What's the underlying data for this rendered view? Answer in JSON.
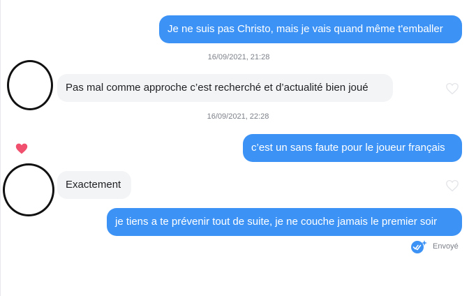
{
  "conversation": {
    "messages": [
      {
        "id": "m1",
        "direction": "sent",
        "text": "Je ne suis pas Christo, mais je vais quand même t'emballer"
      },
      {
        "id": "t1",
        "type": "timestamp",
        "text": "16/09/2021, 21:28"
      },
      {
        "id": "m2",
        "direction": "received",
        "text": "Pas mal comme approche c’est recherché et d’actualité bien joué",
        "liked": false
      },
      {
        "id": "t2",
        "type": "timestamp",
        "text": "16/09/2021, 22:28"
      },
      {
        "id": "m3",
        "direction": "sent",
        "text": "c’est un sans faute pour le joueur français",
        "liked_by_other": true
      },
      {
        "id": "m4",
        "direction": "received",
        "text": "Exactement",
        "liked": false
      },
      {
        "id": "m5",
        "direction": "sent",
        "text": "je tiens a te prévenir tout de suite, je ne couche jamais le premier soir"
      }
    ],
    "delivery_status": "Envoyé"
  },
  "colors": {
    "sent_bubble": "#3d93f5",
    "received_bubble": "#f3f4f6",
    "like_heart": "#f0506e",
    "timestamp": "#7c8088"
  },
  "icons": [
    "heart-outline-icon",
    "heart-filled-icon",
    "double-check-sparkle-icon"
  ]
}
